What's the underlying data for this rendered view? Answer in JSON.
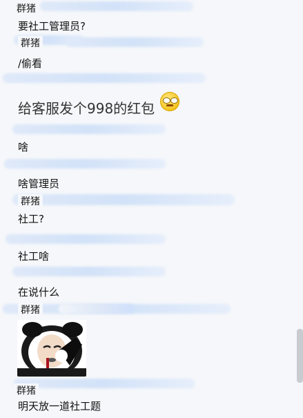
{
  "messages": [
    {
      "sender": "群猪"
    },
    {
      "text": "要社工管理员?"
    },
    {
      "sender": "群猪"
    },
    {
      "text": "/偷看"
    },
    {
      "text": "给客服发个998的红包"
    },
    {
      "text": "啥"
    },
    {
      "text": "啥管理员"
    },
    {
      "sender": "群猪"
    },
    {
      "text": "社工?"
    },
    {
      "text": "社工啥"
    },
    {
      "text": "在说什么"
    },
    {
      "sender": "群猪"
    },
    {
      "sender": "群猪"
    },
    {
      "text": "明天放一道社工题"
    }
  ],
  "icons": {
    "emoji": "sunglasses-smile-emoji-icon",
    "sticker": "panda-meme-sticker"
  }
}
